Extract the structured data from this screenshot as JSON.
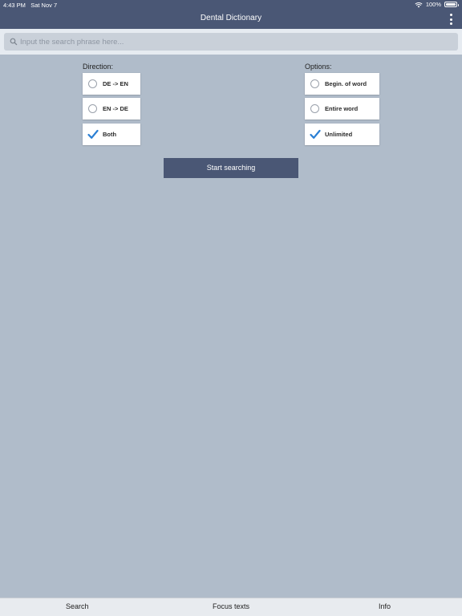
{
  "status_bar": {
    "time": "4:43 PM",
    "date": "Sat Nov 7",
    "battery": "100%"
  },
  "header": {
    "title": "Dental Dictionary"
  },
  "search": {
    "placeholder": "Input the search phrase here...",
    "value": ""
  },
  "direction": {
    "label": "Direction:",
    "options": [
      {
        "label": "DE -> EN",
        "selected": false
      },
      {
        "label": "EN -> DE",
        "selected": false
      },
      {
        "label": "Both",
        "selected": true
      }
    ]
  },
  "options": {
    "label": "Options:",
    "options": [
      {
        "label": "Begin. of word",
        "selected": false
      },
      {
        "label": "Entire word",
        "selected": false
      },
      {
        "label": "Unlimited",
        "selected": true
      }
    ]
  },
  "start_button": {
    "label": "Start searching"
  },
  "tabbar": {
    "tabs": [
      "Search",
      "Focus texts",
      "Info"
    ]
  },
  "colors": {
    "header": "#4a5775",
    "background": "#b0bcca",
    "check": "#2a7fd4"
  }
}
